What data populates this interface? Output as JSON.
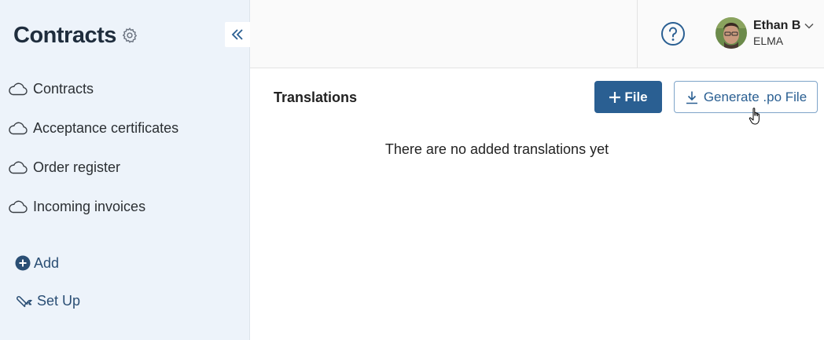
{
  "sidebar": {
    "title": "Contracts",
    "items": [
      {
        "label": "Contracts",
        "icon": "cloud-icon"
      },
      {
        "label": "Acceptance certificates",
        "icon": "cloud-icon"
      },
      {
        "label": "Order register",
        "icon": "cloud-icon"
      },
      {
        "label": "Incoming invoices",
        "icon": "cloud-icon"
      }
    ],
    "add_label": "Add",
    "setup_label": "Set Up"
  },
  "header": {
    "user_name": "Ethan B",
    "user_org": "ELMA"
  },
  "main": {
    "section_title": "Translations",
    "file_button_label": "File",
    "generate_button_label": "Generate .po File",
    "empty_message": "There are no added translations yet"
  },
  "colors": {
    "sidebar_bg": "#edf3fa",
    "primary": "#2a5f92",
    "outline": "#7ea4c9"
  }
}
